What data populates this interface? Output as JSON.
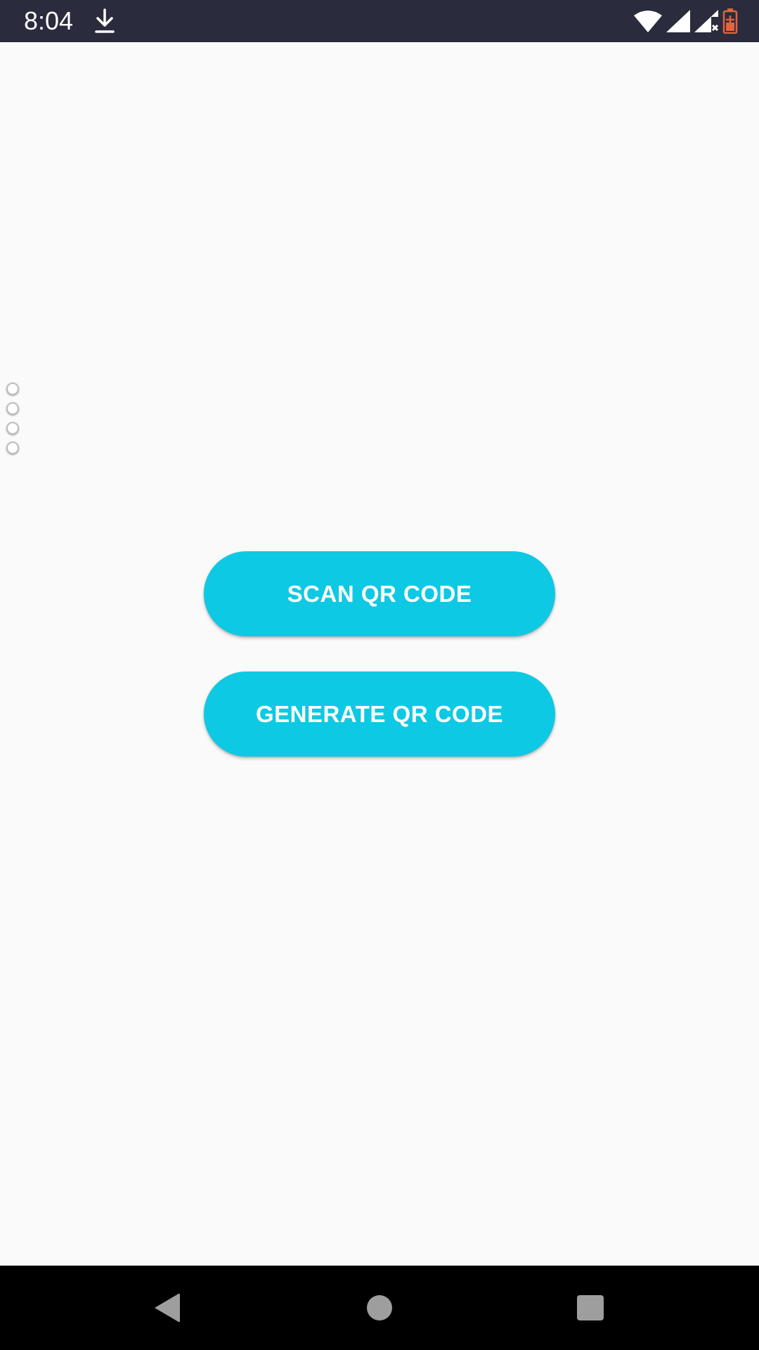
{
  "status_bar": {
    "time": "8:04",
    "icons": [
      "download-icon",
      "wifi-icon",
      "signal-icon",
      "signal-no-data-icon",
      "battery-charging-icon"
    ],
    "battery_color": "#e8623a"
  },
  "main": {
    "scan_button_label": "SCAN QR CODE",
    "generate_button_label": "GENERATE QR CODE",
    "accent_color": "#0ec9e3",
    "side_dots_count": 4
  },
  "nav_bar": {
    "icons": [
      "back-icon",
      "home-icon",
      "recents-icon"
    ]
  }
}
